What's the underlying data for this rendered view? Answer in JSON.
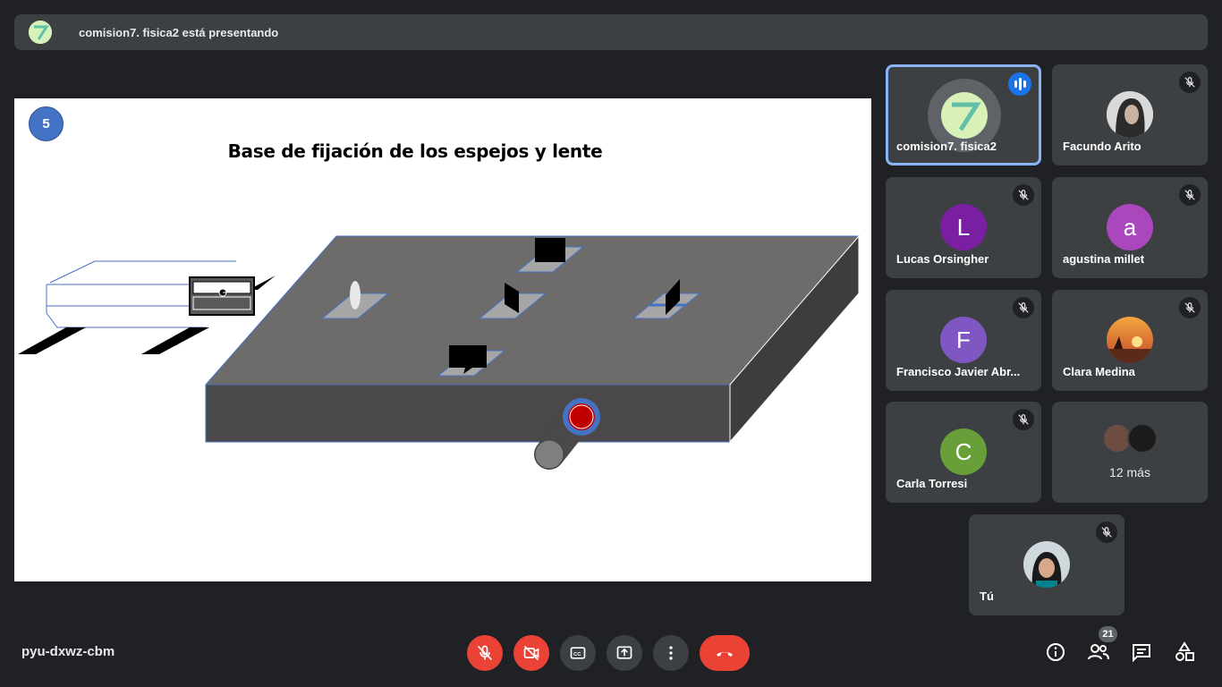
{
  "banner": {
    "presenter_text": "comision7. fisica2 está presentando"
  },
  "slide": {
    "number": "5",
    "title": "Base de fijación de los espejos y lente"
  },
  "participants": [
    {
      "name": "comision7. fisica2",
      "status": "speaking",
      "avatar_type": "logo"
    },
    {
      "name": "Facundo Arito",
      "status": "muted",
      "avatar_type": "photo"
    },
    {
      "name": "Lucas Orsingher",
      "status": "muted",
      "avatar_letter": "L",
      "color": "#7b1fa2"
    },
    {
      "name": "agustina millet",
      "status": "muted",
      "avatar_letter": "a",
      "color": "#ab47bc"
    },
    {
      "name": "Francisco Javier Abr...",
      "status": "muted",
      "avatar_letter": "F",
      "color": "#7e57c2"
    },
    {
      "name": "Clara Medina",
      "status": "muted",
      "avatar_type": "photo"
    },
    {
      "name": "Carla Torresi",
      "status": "muted",
      "avatar_letter": "C",
      "color": "#689f38"
    },
    {
      "more_label": "12 más"
    },
    {
      "name": "Tú",
      "status": "muted",
      "avatar_type": "photo"
    }
  ],
  "bottom": {
    "meeting_code": "pyu-dxwz-cbm",
    "participant_count": "21",
    "controls": [
      "mic-off",
      "camera-off",
      "captions",
      "present",
      "more-options",
      "leave-call"
    ],
    "right_icons": [
      "info",
      "people",
      "chat",
      "activities"
    ]
  },
  "colors": {
    "background": "#202124",
    "tile": "#3c4043",
    "danger": "#ea4335",
    "accent": "#1a73e8"
  }
}
